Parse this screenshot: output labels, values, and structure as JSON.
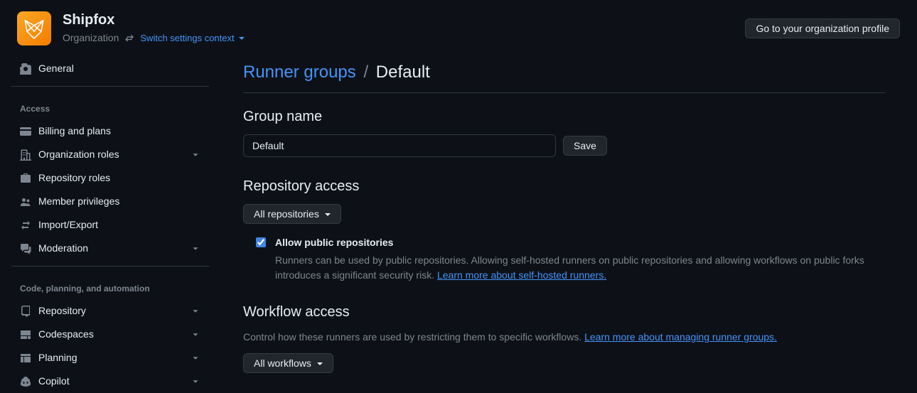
{
  "header": {
    "org_name": "Shipfox",
    "org_label": "Organization",
    "switch_context": "Switch settings context",
    "profile_button": "Go to your organization profile"
  },
  "sidebar": {
    "general": "General",
    "groups": [
      {
        "title": "Access",
        "items": [
          {
            "id": "billing",
            "label": "Billing and plans",
            "icon": "credit-card",
            "expandable": false
          },
          {
            "id": "org-roles",
            "label": "Organization roles",
            "icon": "organization",
            "expandable": true
          },
          {
            "id": "repo-roles",
            "label": "Repository roles",
            "icon": "briefcase",
            "expandable": false
          },
          {
            "id": "member-priv",
            "label": "Member privileges",
            "icon": "people",
            "expandable": false
          },
          {
            "id": "import-export",
            "label": "Import/Export",
            "icon": "arrow-switch",
            "expandable": false
          },
          {
            "id": "moderation",
            "label": "Moderation",
            "icon": "comment-discussion",
            "expandable": true
          }
        ]
      },
      {
        "title": "Code, planning, and automation",
        "items": [
          {
            "id": "repository",
            "label": "Repository",
            "icon": "repo",
            "expandable": true
          },
          {
            "id": "codespaces",
            "label": "Codespaces",
            "icon": "codespaces",
            "expandable": true
          },
          {
            "id": "planning",
            "label": "Planning",
            "icon": "table",
            "expandable": true
          },
          {
            "id": "copilot",
            "label": "Copilot",
            "icon": "copilot",
            "expandable": true
          }
        ]
      }
    ]
  },
  "breadcrumb": {
    "parent": "Runner groups",
    "current": "Default"
  },
  "form": {
    "group_name": {
      "heading": "Group name",
      "value": "Default",
      "save": "Save"
    },
    "repo_access": {
      "heading": "Repository access",
      "select_value": "All repositories",
      "checkbox": {
        "checked": true,
        "label": "Allow public repositories",
        "description": "Runners can be used by public repositories. Allowing self-hosted runners on public repositories and allowing workflows on public forks introduces a significant security risk. ",
        "link": "Learn more about self-hosted runners."
      }
    },
    "workflow_access": {
      "heading": "Workflow access",
      "description": "Control how these runners are used by restricting them to specific workflows. ",
      "link": "Learn more about managing runner groups.",
      "select_value": "All workflows"
    }
  }
}
